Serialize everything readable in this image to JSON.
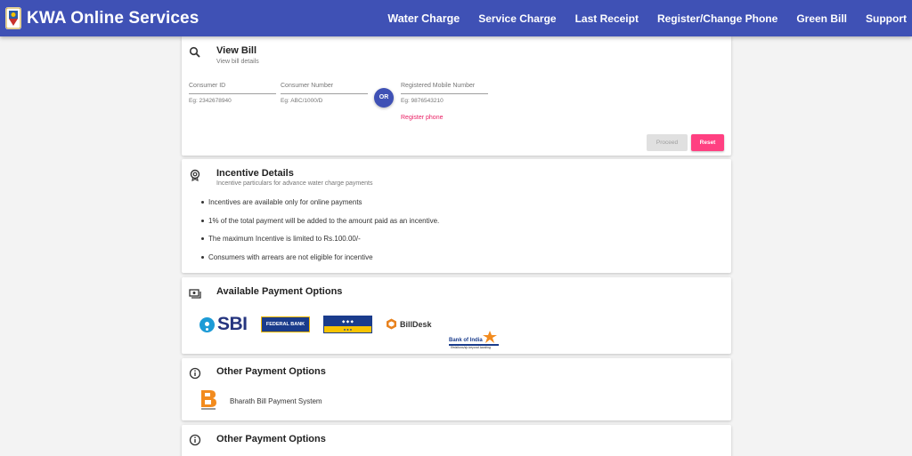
{
  "header": {
    "brand": "KWA Online Services",
    "nav": [
      {
        "label": "Water Charge",
        "active": true
      },
      {
        "label": "Service Charge"
      },
      {
        "label": "Last Receipt"
      },
      {
        "label": "Register/Change Phone"
      },
      {
        "label": "Green Bill"
      },
      {
        "label": "Support"
      }
    ]
  },
  "view_bill": {
    "title": "View Bill",
    "subtitle": "View bill details",
    "consumer_id": {
      "label": "Consumer ID",
      "hint": "Eg: 2342678940"
    },
    "consumer_number": {
      "label": "Consumer Number",
      "hint": "Eg: ABC/1000/D"
    },
    "or_label": "OR",
    "mobile": {
      "label": "Registered Mobile Number",
      "hint": "Eg: 9876543210"
    },
    "register_link": "Register phone",
    "proceed_label": "Proceed",
    "reset_label": "Reset"
  },
  "incentive": {
    "title": "Incentive Details",
    "subtitle": "Incentive particulars for advance water charge payments",
    "items": [
      "Incentives are available only for online payments",
      "1% of the total payment will be added to the amount paid as an incentive.",
      "The maximum Incentive is limited to Rs.100.00/-",
      "Consumers with arrears are not eligible for incentive"
    ]
  },
  "payment_options": {
    "title": "Available Payment Options",
    "banks": {
      "sbi": "SBI",
      "federal": "FEDERAL BANK",
      "billdesk": "BillDesk",
      "boi": "Bank of India",
      "boi_tag": "Relationship beyond banking"
    }
  },
  "other_options": {
    "title": "Other Payment Options",
    "bbps_label": "Bharath Bill Payment System"
  },
  "other_options_2": {
    "title": "Other Payment Options"
  },
  "colors": {
    "primary": "#3f51b5",
    "accent": "#ff4081",
    "link": "#e91e63",
    "background": "#f3f3f3"
  },
  "icons": {
    "view_bill": "search-icon",
    "incentive": "badge-icon",
    "payment": "payments-icon",
    "other": "info-icon"
  }
}
